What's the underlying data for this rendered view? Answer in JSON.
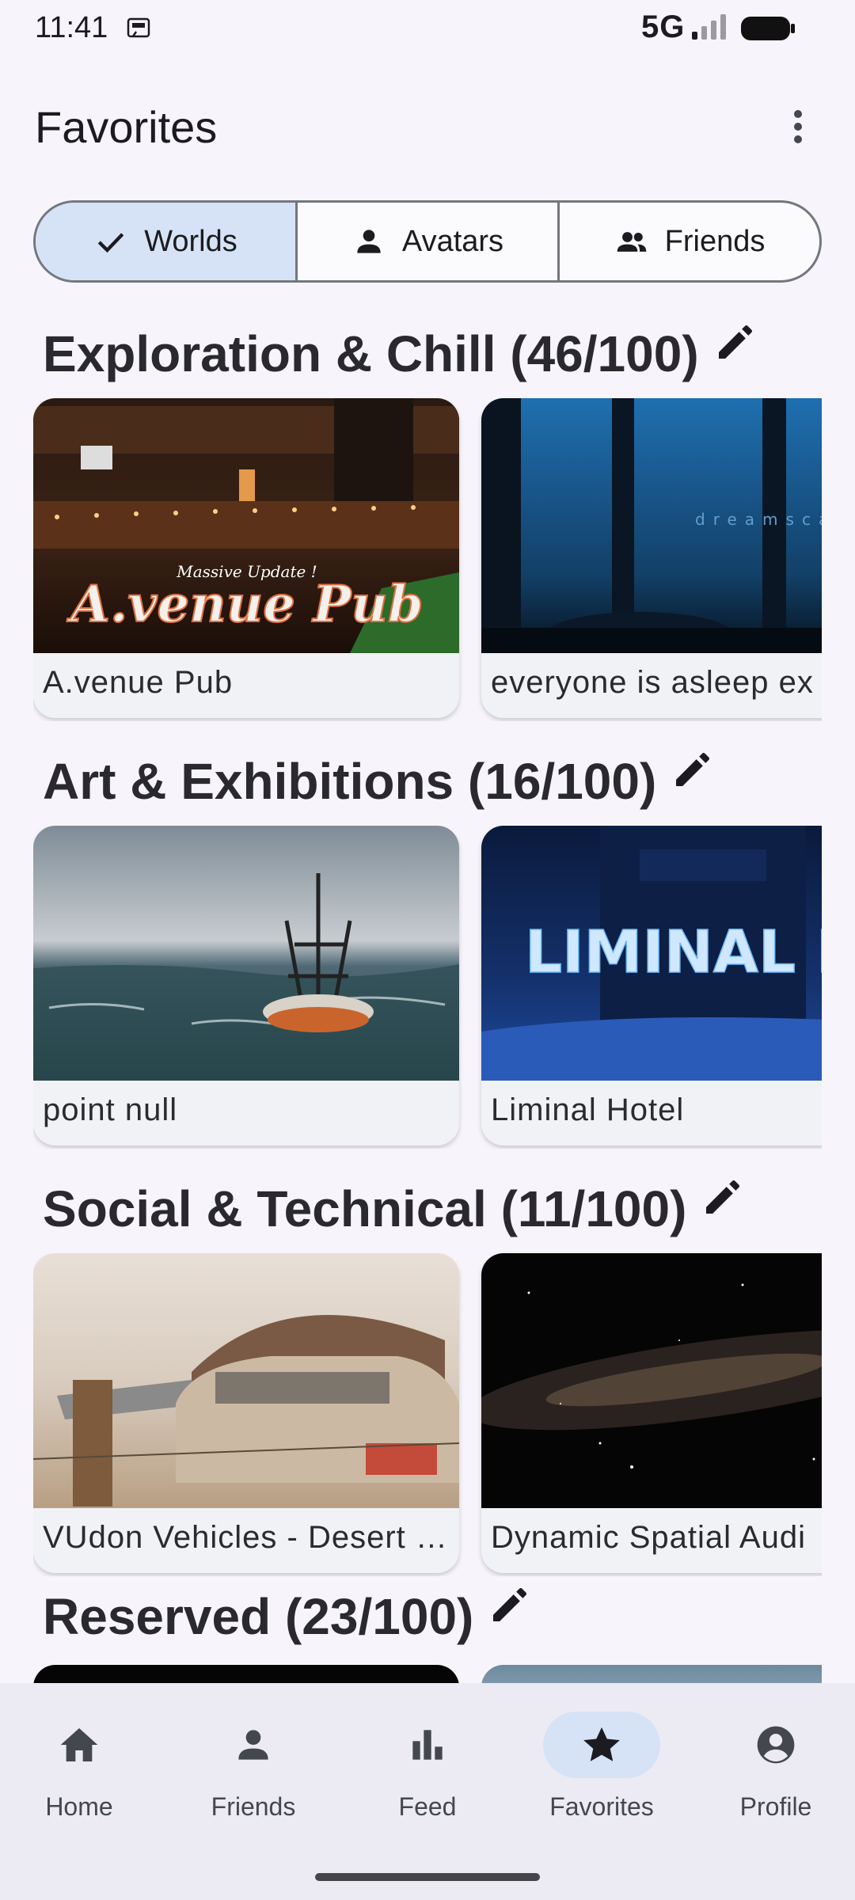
{
  "status_bar": {
    "time": "11:41",
    "network": "5G"
  },
  "header": {
    "title": "Favorites",
    "overflow_icon": "more-vert-icon"
  },
  "tabs": [
    {
      "label": "Worlds",
      "icon": "check-icon",
      "selected": true
    },
    {
      "label": "Avatars",
      "icon": "person-icon",
      "selected": false
    },
    {
      "label": "Friends",
      "icon": "group-icon",
      "selected": false
    }
  ],
  "sections": [
    {
      "title": "Exploration & Chill (46/100)",
      "cards": [
        "A.venue Pub",
        "everyone is asleep ex"
      ]
    },
    {
      "title": "Art & Exhibitions (16/100)",
      "cards": [
        "point null",
        "Liminal Hotel"
      ]
    },
    {
      "title": "Social & Technical (11/100)",
      "cards": [
        "VUdon Vehicles - Desert …",
        "Dynamic Spatial Audi"
      ]
    },
    {
      "title": "Reserved (23/100)",
      "cards": []
    }
  ],
  "image_text": {
    "avenue_small": "Massive Update !",
    "avenue_big": "A.venue Pub",
    "dreamscape": "dreamscape",
    "liminal": "LIMINAL HOTEL"
  },
  "bottom_nav": [
    {
      "label": "Home",
      "icon": "home-icon",
      "active": false
    },
    {
      "label": "Friends",
      "icon": "person-icon",
      "active": false
    },
    {
      "label": "Feed",
      "icon": "bar-chart-icon",
      "active": false
    },
    {
      "label": "Favorites",
      "icon": "star-icon",
      "active": true
    },
    {
      "label": "Profile",
      "icon": "account-circle-icon",
      "active": false
    }
  ],
  "colors": {
    "accent": "#d6e3f7",
    "background": "#f7f5fb",
    "nav_background": "#ecebf3"
  }
}
